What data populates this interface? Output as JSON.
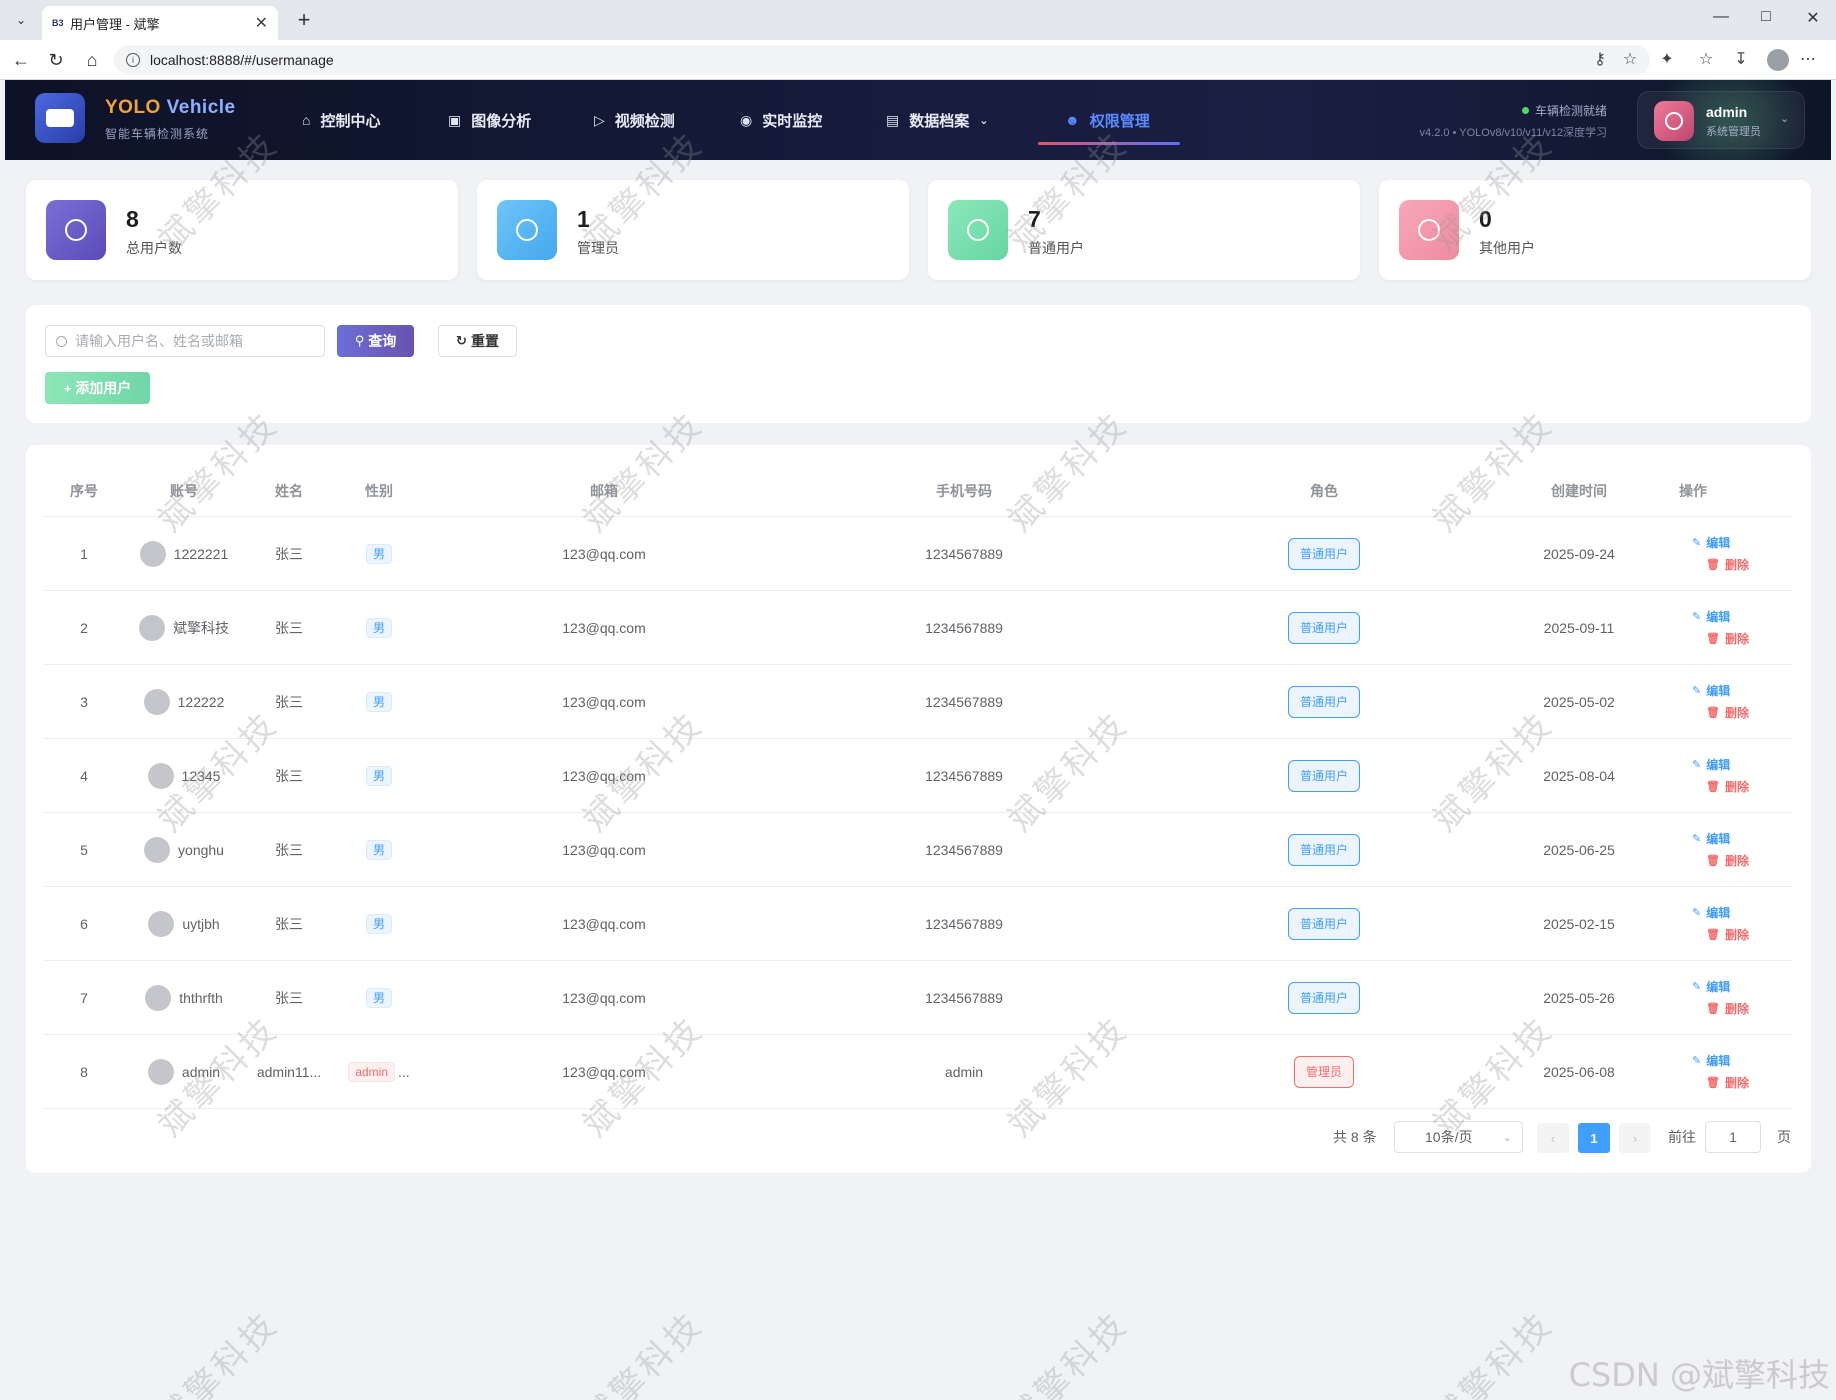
{
  "browser": {
    "tab_favicon": "B3",
    "tab_title": "用户管理 - 斌擎",
    "url": "localhost:8888/#/usermanage"
  },
  "header": {
    "brand_part1": "YOLO",
    "brand_part2": "Vehicle",
    "brand_sub": "智能车辆检测系统",
    "menu": [
      {
        "label": "控制中心",
        "icon": "home-icon"
      },
      {
        "label": "图像分析",
        "icon": "image-icon"
      },
      {
        "label": "视频检测",
        "icon": "play-icon"
      },
      {
        "label": "实时监控",
        "icon": "camera-icon"
      },
      {
        "label": "数据档案",
        "icon": "document-icon"
      },
      {
        "label": "权限管理",
        "icon": "user-icon"
      }
    ],
    "status": "车辆检测就绪",
    "version": "v4.2.0 • YOLOv8/v10/v11/v12深度学习",
    "user_name": "admin",
    "user_role": "系统管理员",
    "status_color": "#4cd964"
  },
  "stats": [
    {
      "value": "8",
      "label": "总用户数",
      "color_from": "#7b6fd6",
      "color_to": "#5b4bb8"
    },
    {
      "value": "1",
      "label": "管理员",
      "color_from": "#6ec4f7",
      "color_to": "#45a8ef"
    },
    {
      "value": "7",
      "label": "普通用户",
      "color_from": "#8ce8b8",
      "color_to": "#66d6a4"
    },
    {
      "value": "0",
      "label": "其他用户",
      "color_from": "#f6a9b8",
      "color_to": "#f08aa0"
    }
  ],
  "search": {
    "placeholder": "请输入用户名、姓名或邮箱",
    "query_label": "查询",
    "reset_label": "重置",
    "add_label": "添加用户"
  },
  "table": {
    "columns": [
      "序号",
      "账号",
      "姓名",
      "性别",
      "邮箱",
      "手机号码",
      "角色",
      "创建时间",
      "操作"
    ],
    "edit_label": "编辑",
    "delete_label": "删除",
    "rows": [
      {
        "idx": "1",
        "account": "1222221",
        "name": "张三",
        "gender": "男",
        "email": "123@qq.com",
        "phone": "1234567889",
        "role": "普通用户",
        "role_type": "blue",
        "created": "2025-09-24"
      },
      {
        "idx": "2",
        "account": "斌擎科技",
        "name": "张三",
        "gender": "男",
        "email": "123@qq.com",
        "phone": "1234567889",
        "role": "普通用户",
        "role_type": "blue",
        "created": "2025-09-11"
      },
      {
        "idx": "3",
        "account": "122222",
        "name": "张三",
        "gender": "男",
        "email": "123@qq.com",
        "phone": "1234567889",
        "role": "普通用户",
        "role_type": "blue",
        "created": "2025-05-02"
      },
      {
        "idx": "4",
        "account": "12345",
        "name": "张三",
        "gender": "男",
        "email": "123@qq.com",
        "phone": "1234567889",
        "role": "普通用户",
        "role_type": "blue",
        "created": "2025-08-04"
      },
      {
        "idx": "5",
        "account": "yonghu",
        "name": "张三",
        "gender": "男",
        "email": "123@qq.com",
        "phone": "1234567889",
        "role": "普通用户",
        "role_type": "blue",
        "created": "2025-06-25"
      },
      {
        "idx": "6",
        "account": "uytjbh",
        "name": "张三",
        "gender": "男",
        "email": "123@qq.com",
        "phone": "1234567889",
        "role": "普通用户",
        "role_type": "blue",
        "created": "2025-02-15"
      },
      {
        "idx": "7",
        "account": "ththrfth",
        "name": "张三",
        "gender": "男",
        "email": "123@qq.com",
        "phone": "1234567889",
        "role": "普通用户",
        "role_type": "blue",
        "created": "2025-05-26"
      },
      {
        "idx": "8",
        "account": "admin",
        "name": "admin11...",
        "gender": "admin",
        "gender_suffix": "...",
        "email": "123@qq.com",
        "phone": "admin",
        "role": "管理员",
        "role_type": "red",
        "created": "2025-06-08"
      }
    ]
  },
  "pagination": {
    "total": "共 8 条",
    "page_size": "10条/页",
    "current": "1",
    "goto_label": "前往",
    "goto_value": "1",
    "page_suffix": "页"
  },
  "watermark": "斌擎科技",
  "footer_mark": "CSDN @斌擎科技"
}
